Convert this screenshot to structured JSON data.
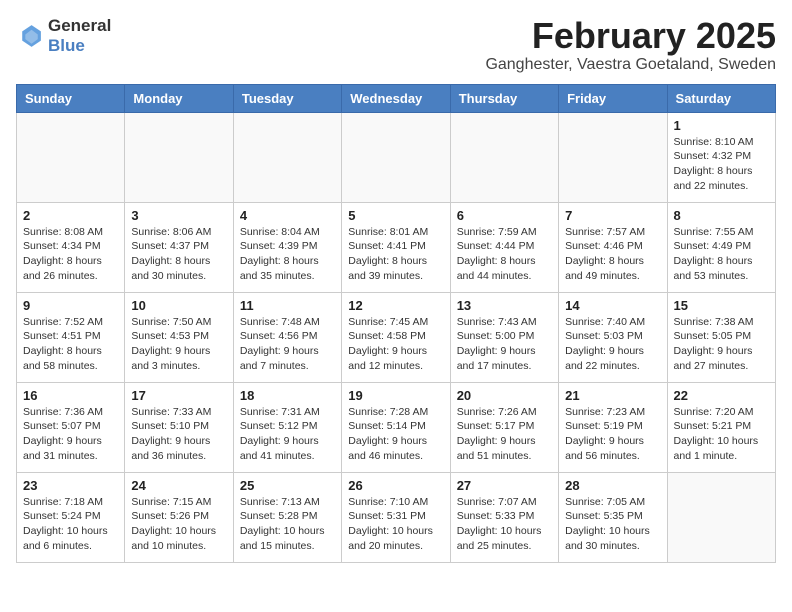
{
  "header": {
    "logo_line1": "General",
    "logo_line2": "Blue",
    "month_year": "February 2025",
    "location": "Ganghester, Vaestra Goetaland, Sweden"
  },
  "weekdays": [
    "Sunday",
    "Monday",
    "Tuesday",
    "Wednesday",
    "Thursday",
    "Friday",
    "Saturday"
  ],
  "weeks": [
    [
      {
        "day": "",
        "info": ""
      },
      {
        "day": "",
        "info": ""
      },
      {
        "day": "",
        "info": ""
      },
      {
        "day": "",
        "info": ""
      },
      {
        "day": "",
        "info": ""
      },
      {
        "day": "",
        "info": ""
      },
      {
        "day": "1",
        "info": "Sunrise: 8:10 AM\nSunset: 4:32 PM\nDaylight: 8 hours and 22 minutes."
      }
    ],
    [
      {
        "day": "2",
        "info": "Sunrise: 8:08 AM\nSunset: 4:34 PM\nDaylight: 8 hours and 26 minutes."
      },
      {
        "day": "3",
        "info": "Sunrise: 8:06 AM\nSunset: 4:37 PM\nDaylight: 8 hours and 30 minutes."
      },
      {
        "day": "4",
        "info": "Sunrise: 8:04 AM\nSunset: 4:39 PM\nDaylight: 8 hours and 35 minutes."
      },
      {
        "day": "5",
        "info": "Sunrise: 8:01 AM\nSunset: 4:41 PM\nDaylight: 8 hours and 39 minutes."
      },
      {
        "day": "6",
        "info": "Sunrise: 7:59 AM\nSunset: 4:44 PM\nDaylight: 8 hours and 44 minutes."
      },
      {
        "day": "7",
        "info": "Sunrise: 7:57 AM\nSunset: 4:46 PM\nDaylight: 8 hours and 49 minutes."
      },
      {
        "day": "8",
        "info": "Sunrise: 7:55 AM\nSunset: 4:49 PM\nDaylight: 8 hours and 53 minutes."
      }
    ],
    [
      {
        "day": "9",
        "info": "Sunrise: 7:52 AM\nSunset: 4:51 PM\nDaylight: 8 hours and 58 minutes."
      },
      {
        "day": "10",
        "info": "Sunrise: 7:50 AM\nSunset: 4:53 PM\nDaylight: 9 hours and 3 minutes."
      },
      {
        "day": "11",
        "info": "Sunrise: 7:48 AM\nSunset: 4:56 PM\nDaylight: 9 hours and 7 minutes."
      },
      {
        "day": "12",
        "info": "Sunrise: 7:45 AM\nSunset: 4:58 PM\nDaylight: 9 hours and 12 minutes."
      },
      {
        "day": "13",
        "info": "Sunrise: 7:43 AM\nSunset: 5:00 PM\nDaylight: 9 hours and 17 minutes."
      },
      {
        "day": "14",
        "info": "Sunrise: 7:40 AM\nSunset: 5:03 PM\nDaylight: 9 hours and 22 minutes."
      },
      {
        "day": "15",
        "info": "Sunrise: 7:38 AM\nSunset: 5:05 PM\nDaylight: 9 hours and 27 minutes."
      }
    ],
    [
      {
        "day": "16",
        "info": "Sunrise: 7:36 AM\nSunset: 5:07 PM\nDaylight: 9 hours and 31 minutes."
      },
      {
        "day": "17",
        "info": "Sunrise: 7:33 AM\nSunset: 5:10 PM\nDaylight: 9 hours and 36 minutes."
      },
      {
        "day": "18",
        "info": "Sunrise: 7:31 AM\nSunset: 5:12 PM\nDaylight: 9 hours and 41 minutes."
      },
      {
        "day": "19",
        "info": "Sunrise: 7:28 AM\nSunset: 5:14 PM\nDaylight: 9 hours and 46 minutes."
      },
      {
        "day": "20",
        "info": "Sunrise: 7:26 AM\nSunset: 5:17 PM\nDaylight: 9 hours and 51 minutes."
      },
      {
        "day": "21",
        "info": "Sunrise: 7:23 AM\nSunset: 5:19 PM\nDaylight: 9 hours and 56 minutes."
      },
      {
        "day": "22",
        "info": "Sunrise: 7:20 AM\nSunset: 5:21 PM\nDaylight: 10 hours and 1 minute."
      }
    ],
    [
      {
        "day": "23",
        "info": "Sunrise: 7:18 AM\nSunset: 5:24 PM\nDaylight: 10 hours and 6 minutes."
      },
      {
        "day": "24",
        "info": "Sunrise: 7:15 AM\nSunset: 5:26 PM\nDaylight: 10 hours and 10 minutes."
      },
      {
        "day": "25",
        "info": "Sunrise: 7:13 AM\nSunset: 5:28 PM\nDaylight: 10 hours and 15 minutes."
      },
      {
        "day": "26",
        "info": "Sunrise: 7:10 AM\nSunset: 5:31 PM\nDaylight: 10 hours and 20 minutes."
      },
      {
        "day": "27",
        "info": "Sunrise: 7:07 AM\nSunset: 5:33 PM\nDaylight: 10 hours and 25 minutes."
      },
      {
        "day": "28",
        "info": "Sunrise: 7:05 AM\nSunset: 5:35 PM\nDaylight: 10 hours and 30 minutes."
      },
      {
        "day": "",
        "info": ""
      }
    ]
  ]
}
